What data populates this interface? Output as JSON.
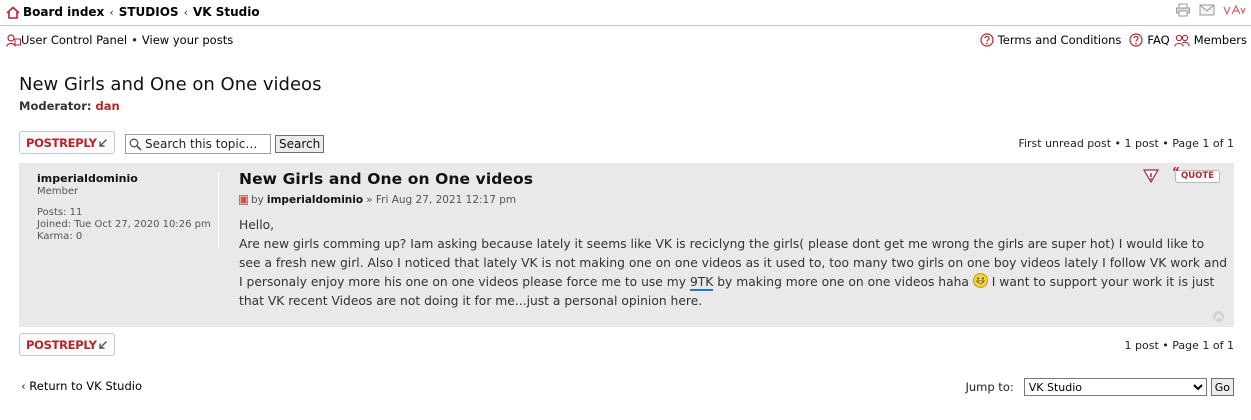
{
  "breadcrumb": {
    "items": [
      "Board index",
      "STUDIOS",
      "VK Studio"
    ],
    "separator": "‹"
  },
  "nav": {
    "left": [
      "User Control Panel",
      "View your posts"
    ],
    "bullet": "•",
    "right": [
      "Terms and Conditions",
      "FAQ",
      "Members"
    ]
  },
  "forum": {
    "title": "New Girls and One on One videos",
    "moderator_label": "Moderator:",
    "moderator_name": "dan"
  },
  "actions": {
    "post_reply_label": "POSTREPLY",
    "search_placeholder": "Search this topic…",
    "search_button": "Search",
    "pagination_top": "First unread post • 1 post • Page 1 of 1",
    "pagination_bottom": "1 post • Page 1 of 1"
  },
  "post": {
    "username": "imperialdominio",
    "rank": "Member",
    "stats": {
      "posts": "Posts: 11",
      "joined": "Joined: Tue Oct 27, 2020 10:26 pm",
      "karma": "Karma: 0"
    },
    "title": "New Girls and One on One videos",
    "by": "by",
    "author": "imperialdominio",
    "date": "» Fri Aug 27, 2021 12:17 pm",
    "quote_label": "QUOTE",
    "greeting": "Hello,",
    "body_part1": "Are new girls comming up? Iam asking because lately it seems like VK is reciclyng the girls( please dont get me wrong the girls are super hot) I would like to see a fresh new girl. Also I noticed that lately VK is not making one on one videos as it used to, too many two girls on one boy videos lately I follow VK work and I personaly enjoy more his one on one videos please force me to use my ",
    "body_link": "9TK",
    "body_part2": " by making more one on one videos haha ",
    "body_part3": " I want to support your work it is just that VK recent Videos are not doing it for me...just a personal opinion here."
  },
  "footer": {
    "return_label": "Return to VK Studio",
    "jump_label": "Jump to:",
    "jump_selected": "VK Studio",
    "go_label": "Go"
  },
  "colors": {
    "accent_red": "#b3262c",
    "post_bg": "#e9e9e9",
    "link_underline": "#2b6fd1"
  }
}
